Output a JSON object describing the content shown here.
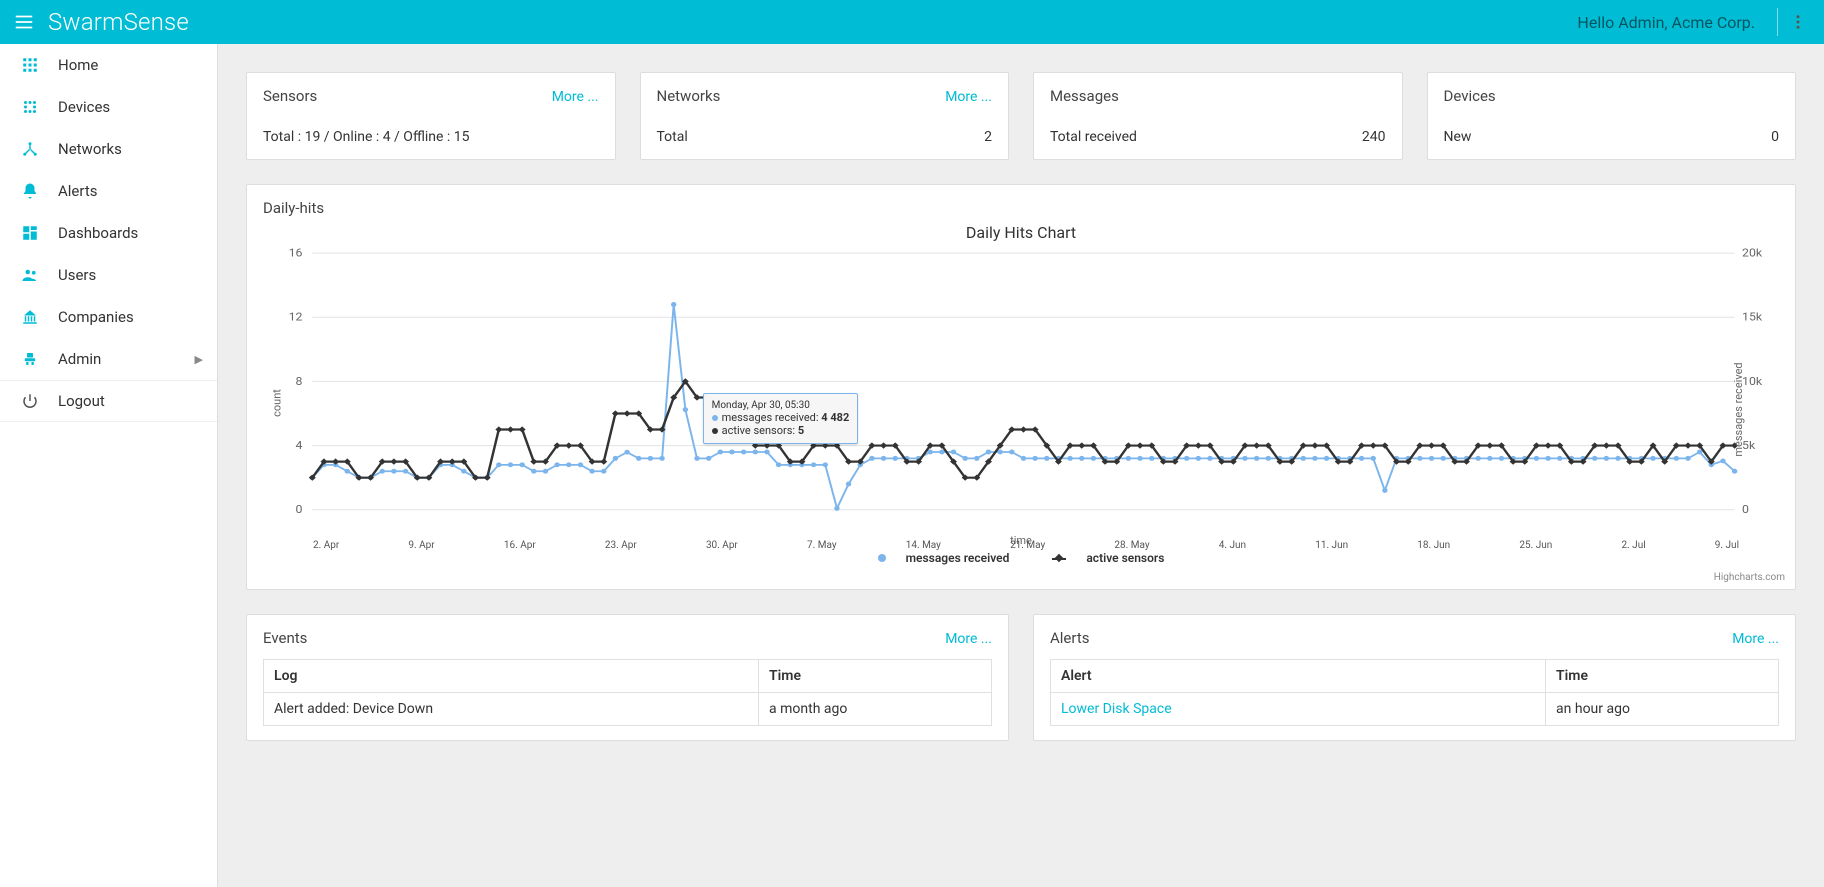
{
  "app": {
    "name": "SwarmSense",
    "greeting": "Hello Admin, Acme Corp."
  },
  "sidebar": {
    "items": [
      {
        "label": "Home",
        "icon": "grid"
      },
      {
        "label": "Devices",
        "icon": "dots"
      },
      {
        "label": "Networks",
        "icon": "hub"
      },
      {
        "label": "Alerts",
        "icon": "bell"
      },
      {
        "label": "Dashboards",
        "icon": "dash"
      },
      {
        "label": "Users",
        "icon": "users"
      },
      {
        "label": "Companies",
        "icon": "bank"
      },
      {
        "label": "Admin",
        "icon": "seat",
        "hasSubmenu": true
      }
    ],
    "logout_label": "Logout"
  },
  "summary_cards": {
    "sensors": {
      "title": "Sensors",
      "link": "More ...",
      "body_left": "Total : 19 / Online : 4 / Offline : 15",
      "body_right": ""
    },
    "networks": {
      "title": "Networks",
      "link": "More ...",
      "body_left": "Total",
      "body_right": "2"
    },
    "messages": {
      "title": "Messages",
      "link": "",
      "body_left": "Total received",
      "body_right": "240"
    },
    "devices": {
      "title": "Devices",
      "link": "",
      "body_left": "New",
      "body_right": "0"
    }
  },
  "chart": {
    "section_title": "Daily-hits",
    "title": "Daily Hits Chart",
    "xlabel": "time",
    "ylabel_left": "count",
    "ylabel_right": "messages received",
    "legend_messages": "messages received",
    "legend_sensors": "active sensors",
    "credit": "Highcharts.com",
    "tooltip": {
      "header": "Monday, Apr 30, 05:30",
      "row1_label": "messages received:",
      "row1_value": "4 482",
      "row2_label": "active sensors:",
      "row2_value": "5"
    }
  },
  "events_panel": {
    "title": "Events",
    "link": "More ...",
    "col_log": "Log",
    "col_time": "Time",
    "rows": [
      {
        "log": "Alert added: Device Down",
        "time": "a month ago"
      }
    ]
  },
  "alerts_panel": {
    "title": "Alerts",
    "link": "More ...",
    "col_alert": "Alert",
    "col_time": "Time",
    "rows": [
      {
        "alert": "Lower Disk Space",
        "time": "an hour ago"
      }
    ]
  },
  "chart_data": {
    "type": "line",
    "title": "Daily Hits Chart",
    "xlabel": "time",
    "x_ticks": [
      "2. Apr",
      "9. Apr",
      "16. Apr",
      "23. Apr",
      "30. Apr",
      "7. May",
      "14. May",
      "21. May",
      "28. May",
      "4. Jun",
      "11. Jun",
      "18. Jun",
      "25. Jun",
      "2. Jul",
      "9. Jul"
    ],
    "y_left": {
      "label": "count",
      "ticks": [
        0,
        4,
        8,
        12,
        16
      ]
    },
    "y_right": {
      "label": "messages received",
      "ticks": [
        0,
        "5k",
        "10k",
        "15k",
        "20k"
      ]
    },
    "series": [
      {
        "name": "active sensors",
        "axis": "left",
        "color": "#333",
        "values": [
          2,
          3,
          3,
          3,
          2,
          2,
          3,
          3,
          3,
          2,
          2,
          3,
          3,
          3,
          2,
          2,
          5,
          5,
          5,
          3,
          3,
          4,
          4,
          4,
          3,
          3,
          6,
          6,
          6,
          5,
          5,
          7,
          8,
          7,
          7,
          7,
          7,
          5,
          4,
          4,
          4,
          3,
          3,
          4,
          4,
          4,
          3,
          3,
          4,
          4,
          4,
          3,
          3,
          4,
          4,
          3,
          2,
          2,
          3,
          4,
          5,
          5,
          5,
          4,
          3,
          4,
          4,
          4,
          3,
          3,
          4,
          4,
          4,
          3,
          3,
          4,
          4,
          4,
          3,
          3,
          4,
          4,
          4,
          3,
          3,
          4,
          4,
          4,
          3,
          3,
          4,
          4,
          4,
          3,
          3,
          4,
          4,
          4,
          3,
          3,
          4,
          4,
          4,
          3,
          3,
          4,
          4,
          4,
          3,
          3,
          4,
          4,
          4,
          3,
          3,
          4,
          3,
          4,
          4,
          4,
          3,
          4,
          4
        ]
      },
      {
        "name": "messages received",
        "axis": "right",
        "color": "#7cb5ec",
        "values": [
          2500,
          3500,
          3500,
          3000,
          2500,
          2500,
          3000,
          3000,
          3000,
          2500,
          2500,
          3500,
          3500,
          3000,
          2500,
          2500,
          3500,
          3500,
          3500,
          3000,
          3000,
          3500,
          3500,
          3500,
          3000,
          3000,
          4000,
          4482,
          4000,
          4000,
          4000,
          16000,
          7800,
          4000,
          4000,
          4500,
          4500,
          4500,
          4500,
          4500,
          3500,
          3500,
          3500,
          3500,
          3500,
          100,
          2000,
          3500,
          4000,
          4000,
          4000,
          4000,
          4000,
          4500,
          4500,
          4500,
          4000,
          4000,
          4500,
          4500,
          4500,
          4000,
          4000,
          4000,
          4000,
          4000,
          4000,
          4000,
          4000,
          4000,
          4000,
          4000,
          4000,
          4000,
          4000,
          4000,
          4000,
          4000,
          4000,
          4000,
          4000,
          4000,
          4000,
          4000,
          4000,
          4000,
          4000,
          4000,
          4000,
          4000,
          4000,
          4000,
          1500,
          4000,
          4000,
          4000,
          4000,
          4000,
          4000,
          4000,
          4000,
          4000,
          4000,
          4000,
          4000,
          4000,
          4000,
          4000,
          4000,
          4000,
          4000,
          4000,
          4000,
          4000,
          4000,
          4000,
          4000,
          4000,
          4000,
          4500,
          3500,
          3800,
          3000
        ]
      }
    ],
    "tooltip_point": {
      "x_label": "Monday, Apr 30, 05:30",
      "messages_received": 4482,
      "active_sensors": 5
    }
  }
}
